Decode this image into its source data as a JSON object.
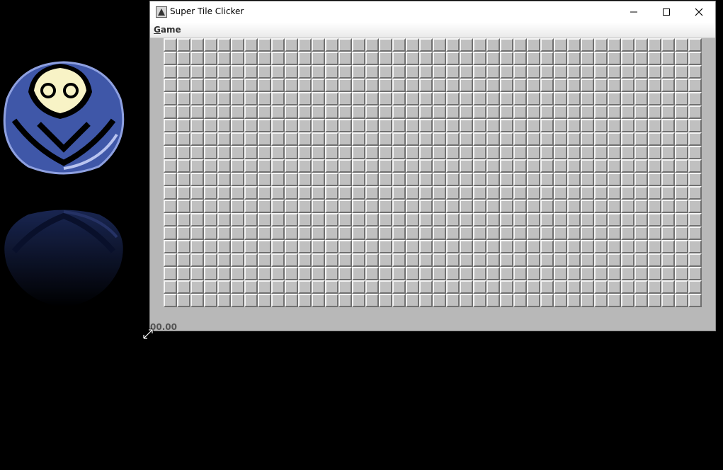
{
  "window": {
    "title": "Super Tile Clicker",
    "controls": [
      "minimize-icon",
      "maximize-icon",
      "close-icon"
    ]
  },
  "menu": {
    "game_mnemonic": "G",
    "game_rest": "ame"
  },
  "board": {
    "columns": 40,
    "rows": 20,
    "tile_state": "unrevealed"
  },
  "status": {
    "timer": "00.00"
  },
  "colors": {
    "desktop": "#000000",
    "window_bg": "#b8b8b8",
    "tile": "#c0c0c0",
    "logo_blue": "#3f57a8",
    "logo_face": "#f8f3c6"
  }
}
